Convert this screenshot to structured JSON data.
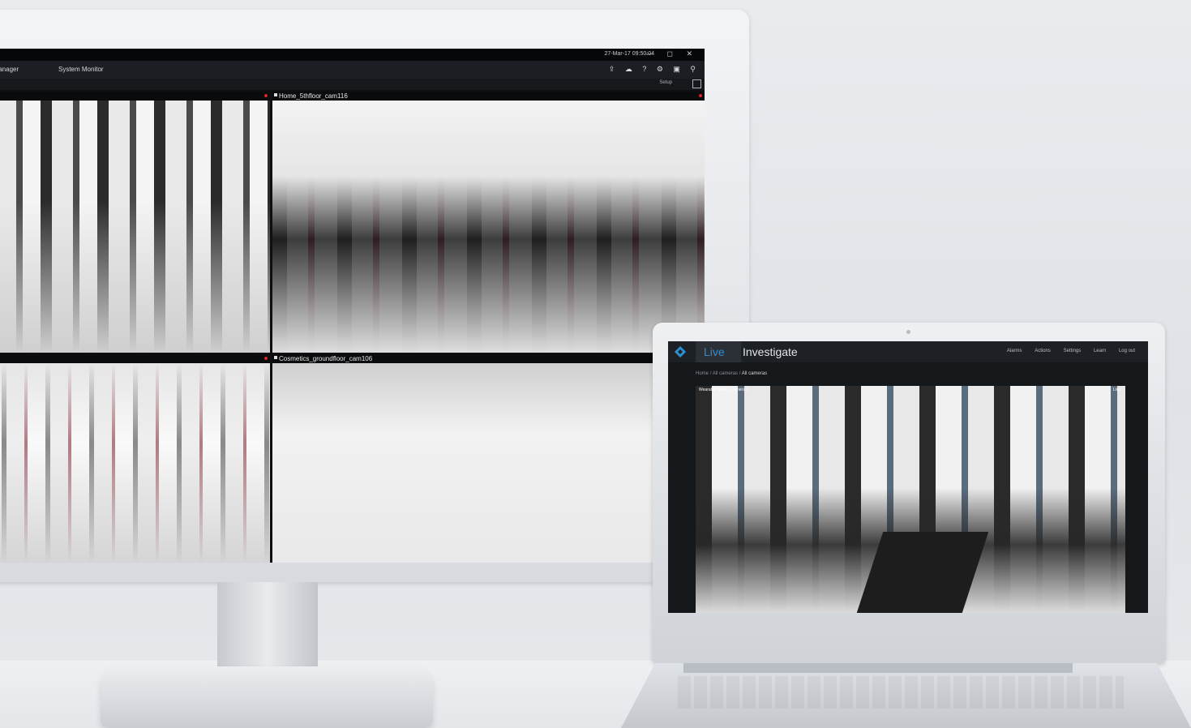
{
  "monitor": {
    "clock": "27-Mar-17 09:50:04",
    "window_buttons": "— ◻ ✕",
    "menu": {
      "tab1": "rm Manager",
      "tab2": "System Monitor"
    },
    "toolbar_icons": "⇪ ☁ ? ⚙ ▣ ⚲",
    "setup_label": "Setup",
    "tiles": [
      {
        "title": ""
      },
      {
        "title": "Home_5thfloor_cam116"
      },
      {
        "title": ""
      },
      {
        "title": "Cosmetics_groundfloor_cam106"
      }
    ]
  },
  "laptop": {
    "tabs": {
      "live": "Live",
      "investigate": "Investigate"
    },
    "nav_links": [
      "Alarms",
      "Actions",
      "Settings",
      "Learn",
      "Log out"
    ],
    "breadcrumb": {
      "home": "Home",
      "sep1": "/",
      "all_cameras_1": "All cameras",
      "sep2": "/",
      "current": "All cameras"
    },
    "feed": {
      "title": "Wearable Store - Camera 1",
      "status": "Live"
    }
  },
  "colors": {
    "accent": "#2b8fd6",
    "selection": "#3a93d6",
    "record": "#dd2222"
  }
}
